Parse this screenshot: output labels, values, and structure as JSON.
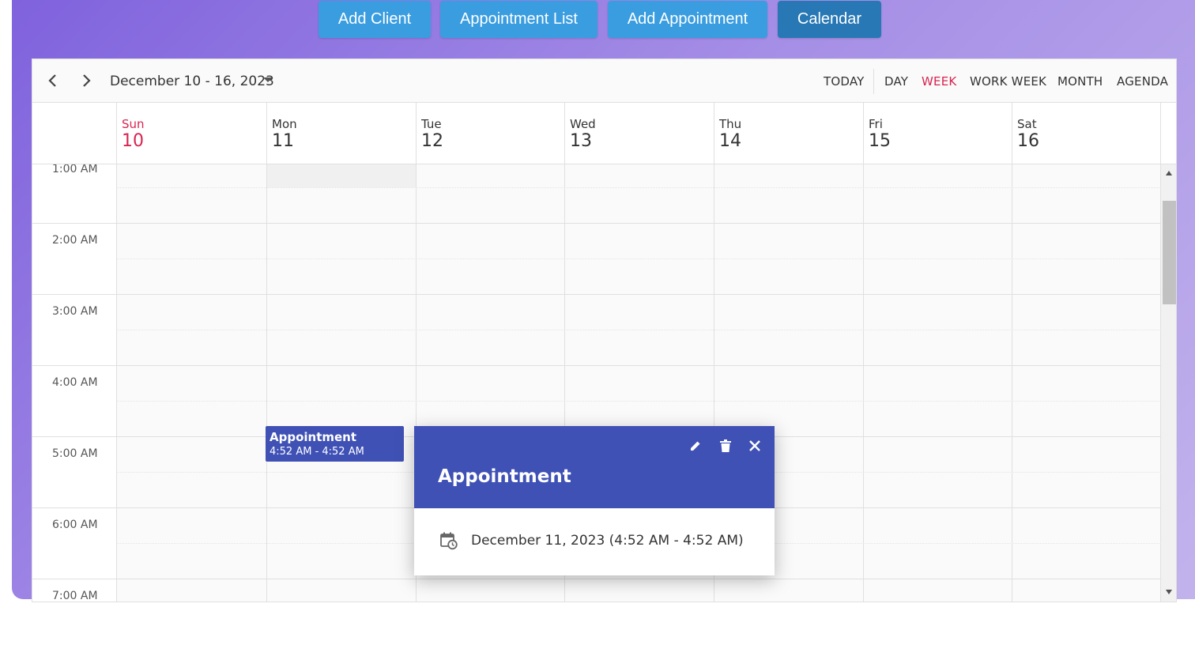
{
  "nav": {
    "add_client": "Add Client",
    "appointment_list": "Appointment List",
    "add_appointment": "Add Appointment",
    "calendar": "Calendar"
  },
  "toolbar": {
    "date_range": "December 10 - 16, 2023",
    "today": "TODAY",
    "views": [
      "DAY",
      "WEEK",
      "WORK WEEK",
      "MONTH",
      "AGENDA"
    ],
    "active_view": "WEEK"
  },
  "days": [
    {
      "name": "Sun",
      "num": "10",
      "today": true
    },
    {
      "name": "Mon",
      "num": "11"
    },
    {
      "name": "Tue",
      "num": "12"
    },
    {
      "name": "Wed",
      "num": "13"
    },
    {
      "name": "Thu",
      "num": "14"
    },
    {
      "name": "Fri",
      "num": "15"
    },
    {
      "name": "Sat",
      "num": "16"
    }
  ],
  "times": [
    "1:00 AM",
    "2:00 AM",
    "3:00 AM",
    "4:00 AM",
    "5:00 AM",
    "6:00 AM",
    "7:00 AM"
  ],
  "appointment": {
    "title": "Appointment",
    "time": "4:52 AM - 4:52 AM"
  },
  "popup": {
    "title": "Appointment",
    "date_text": "December 11, 2023 (4:52 AM - 4:52 AM)"
  },
  "colors": {
    "accent": "#d8244f",
    "event": "#3f51b5",
    "nav_button": "#3a9de0",
    "nav_button_active": "#2778b5"
  }
}
